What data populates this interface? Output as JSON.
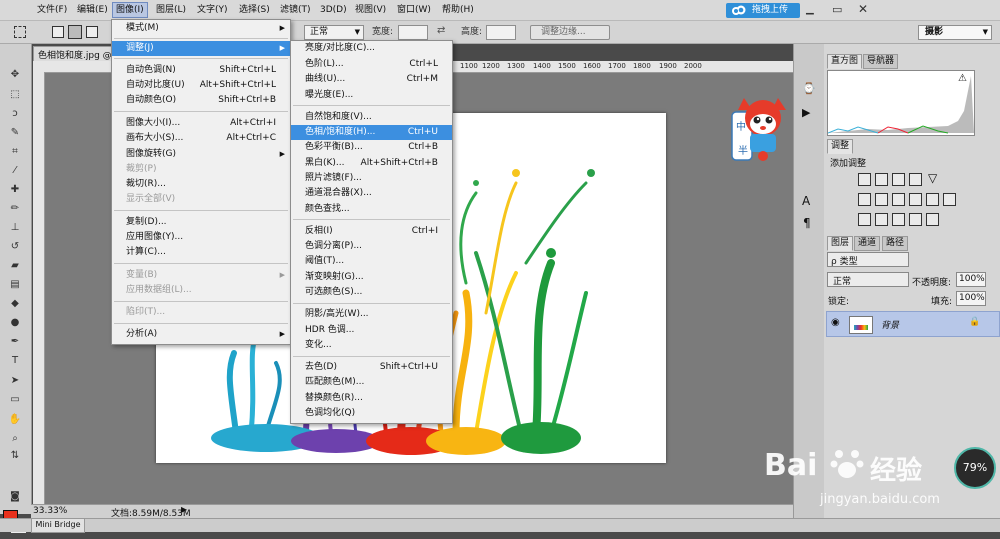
{
  "menubar": {
    "items": [
      "文件(F)",
      "编辑(E)",
      "图像(I)",
      "图层(L)",
      "文字(Y)",
      "选择(S)",
      "滤镜(T)",
      "3D(D)",
      "视图(V)",
      "窗口(W)",
      "帮助(H)"
    ],
    "upload_label": "拖拽上传",
    "workspace": "摄影"
  },
  "options": {
    "mode_label": "正常",
    "width_label": "宽度:",
    "height_label": "高度:",
    "edge_button": "调整边缘..."
  },
  "document": {
    "tab_title": "色相饱和度.jpg @",
    "zoom": "33.33%",
    "doc_info": "文档:8.59M/8.53M",
    "ruler_labels": [
      "1100",
      "1200",
      "1300",
      "1400",
      "1500",
      "1600",
      "1700",
      "1800",
      "1900",
      "2000"
    ]
  },
  "image_menu": {
    "items": [
      {
        "label": "模式(M)",
        "shortcut": "",
        "submenu": true,
        "disabled": false
      },
      {
        "label": "调整(J)",
        "shortcut": "",
        "submenu": true,
        "disabled": false,
        "highlight": true
      },
      {
        "label": "自动色调(N)",
        "shortcut": "Shift+Ctrl+L",
        "disabled": false
      },
      {
        "label": "自动对比度(U)",
        "shortcut": "Alt+Shift+Ctrl+L",
        "disabled": false
      },
      {
        "label": "自动颜色(O)",
        "shortcut": "Shift+Ctrl+B",
        "disabled": false
      },
      {
        "label": "图像大小(I)...",
        "shortcut": "Alt+Ctrl+I",
        "disabled": false
      },
      {
        "label": "画布大小(S)...",
        "shortcut": "Alt+Ctrl+C",
        "disabled": false
      },
      {
        "label": "图像旋转(G)",
        "shortcut": "",
        "submenu": true,
        "disabled": false
      },
      {
        "label": "裁剪(P)",
        "shortcut": "",
        "disabled": true
      },
      {
        "label": "裁切(R)...",
        "shortcut": "",
        "disabled": false
      },
      {
        "label": "显示全部(V)",
        "shortcut": "",
        "disabled": true
      },
      {
        "label": "复制(D)...",
        "shortcut": "",
        "disabled": false
      },
      {
        "label": "应用图像(Y)...",
        "shortcut": "",
        "disabled": false
      },
      {
        "label": "计算(C)...",
        "shortcut": "",
        "disabled": false
      },
      {
        "label": "变量(B)",
        "shortcut": "",
        "submenu": true,
        "disabled": true
      },
      {
        "label": "应用数据组(L)...",
        "shortcut": "",
        "disabled": true
      },
      {
        "label": "陷印(T)...",
        "shortcut": "",
        "disabled": true
      },
      {
        "label": "分析(A)",
        "shortcut": "",
        "submenu": true,
        "disabled": false
      }
    ]
  },
  "adjust_menu": {
    "items": [
      {
        "label": "亮度/对比度(C)...",
        "shortcut": ""
      },
      {
        "label": "色阶(L)...",
        "shortcut": "Ctrl+L"
      },
      {
        "label": "曲线(U)...",
        "shortcut": "Ctrl+M"
      },
      {
        "label": "曝光度(E)...",
        "shortcut": ""
      },
      {
        "label": "自然饱和度(V)...",
        "shortcut": ""
      },
      {
        "label": "色相/饱和度(H)...",
        "shortcut": "Ctrl+U",
        "highlight": true
      },
      {
        "label": "色彩平衡(B)...",
        "shortcut": "Ctrl+B"
      },
      {
        "label": "黑白(K)...",
        "shortcut": "Alt+Shift+Ctrl+B"
      },
      {
        "label": "照片滤镜(F)...",
        "shortcut": ""
      },
      {
        "label": "通道混合器(X)...",
        "shortcut": ""
      },
      {
        "label": "颜色查找...",
        "shortcut": ""
      },
      {
        "label": "反相(I)",
        "shortcut": "Ctrl+I"
      },
      {
        "label": "色调分离(P)...",
        "shortcut": ""
      },
      {
        "label": "阈值(T)...",
        "shortcut": ""
      },
      {
        "label": "渐变映射(G)...",
        "shortcut": ""
      },
      {
        "label": "可选颜色(S)...",
        "shortcut": ""
      },
      {
        "label": "阴影/高光(W)...",
        "shortcut": ""
      },
      {
        "label": "HDR 色调...",
        "shortcut": ""
      },
      {
        "label": "变化...",
        "shortcut": ""
      },
      {
        "label": "去色(D)",
        "shortcut": "Shift+Ctrl+U"
      },
      {
        "label": "匹配颜色(M)...",
        "shortcut": ""
      },
      {
        "label": "替换颜色(R)...",
        "shortcut": ""
      },
      {
        "label": "色调均化(Q)",
        "shortcut": ""
      }
    ]
  },
  "panels": {
    "histogram_tab": "直方图",
    "navigator_tab": "导航器",
    "adjust_tab": "调整",
    "add_adjust": "添加调整",
    "layers_tab": "图层",
    "channels_tab": "通道",
    "paths_tab": "路径",
    "kind_label": "ρ 类型",
    "blend_mode": "正常",
    "opacity_label": "不透明度:",
    "opacity_value": "100%",
    "lock_label": "锁定:",
    "fill_label": "填充:",
    "fill_value": "100%",
    "layer_name": "背景"
  },
  "mascot_text": [
    "中",
    "半"
  ],
  "bottom": {
    "mini_bridge": "Mini Bridge"
  },
  "overlay": {
    "percent": "79%",
    "watermark_brand": "Bai",
    "watermark_cn": "经验",
    "watermark_url": "jingyan.baidu.com"
  }
}
